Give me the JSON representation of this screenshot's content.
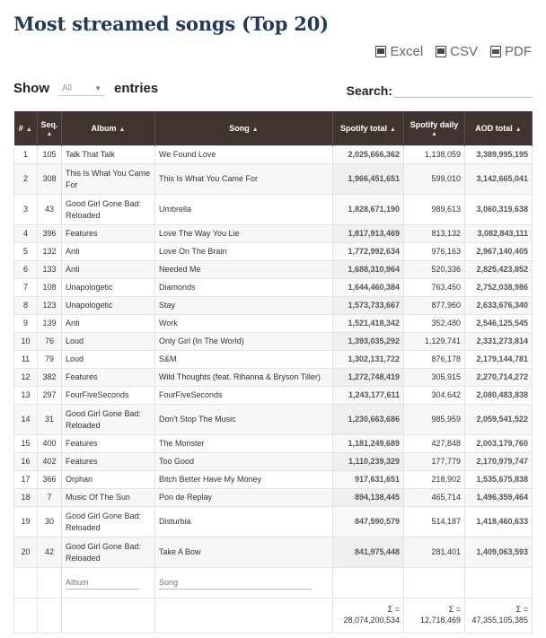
{
  "title": "Most streamed songs (Top 20)",
  "exports": [
    {
      "label": "Excel",
      "icon": "excel-icon"
    },
    {
      "label": "CSV",
      "icon": "csv-icon"
    },
    {
      "label": "PDF",
      "icon": "pdf-icon"
    }
  ],
  "controls": {
    "show_label": "Show",
    "length_value": "All",
    "entries_label": "entries",
    "search_label": "Search:",
    "search_value": ""
  },
  "table": {
    "headers": [
      "#",
      "Seq.",
      "Album",
      "Song",
      "Spotify total",
      "Spotify daily",
      "AOD total"
    ],
    "rows": [
      [
        "1",
        "105",
        "Talk That Talk",
        "We Found Love",
        "2,025,666,362",
        "1,138,059",
        "3,389,995,195"
      ],
      [
        "2",
        "308",
        "This Is What You Came For",
        "This Is What You Came For",
        "1,966,451,651",
        "599,010",
        "3,142,665,041"
      ],
      [
        "3",
        "43",
        "Good Girl Gone Bad: Reloaded",
        "Umbrella",
        "1,828,671,190",
        "989,613",
        "3,060,319,638"
      ],
      [
        "4",
        "396",
        "Features",
        "Love The Way You Lie",
        "1,817,913,469",
        "813,132",
        "3,082,843,111"
      ],
      [
        "5",
        "132",
        "Anti",
        "Love On The Brain",
        "1,772,992,634",
        "976,163",
        "2,967,140,405"
      ],
      [
        "6",
        "133",
        "Anti",
        "Needed Me",
        "1,688,310,964",
        "520,336",
        "2,825,423,852"
      ],
      [
        "7",
        "108",
        "Unapologetic",
        "Diamonds",
        "1,644,460,384",
        "763,450",
        "2,752,038,986"
      ],
      [
        "8",
        "123",
        "Unapologetic",
        "Stay",
        "1,573,733,667",
        "877,960",
        "2,633,676,340"
      ],
      [
        "9",
        "139",
        "Anti",
        "Work",
        "1,521,418,342",
        "352,480",
        "2,546,125,545"
      ],
      [
        "10",
        "76",
        "Loud",
        "Only Girl (In The World)",
        "1,393,035,292",
        "1,129,741",
        "2,331,273,814"
      ],
      [
        "11",
        "79",
        "Loud",
        "S&M",
        "1,302,131,722",
        "876,178",
        "2,179,144,781"
      ],
      [
        "12",
        "382",
        "Features",
        "Wild Thoughts (feat. Rihanna & Bryson Tiller)",
        "1,272,748,419",
        "305,915",
        "2,270,714,272"
      ],
      [
        "13",
        "297",
        "FourFiveSeconds",
        "FourFiveSeconds",
        "1,243,177,611",
        "304,642",
        "2,080,483,838"
      ],
      [
        "14",
        "31",
        "Good Girl Gone Bad: Reloaded",
        "Don't Stop The Music",
        "1,230,663,686",
        "985,959",
        "2,059,541,522"
      ],
      [
        "15",
        "400",
        "Features",
        "The Monster",
        "1,181,249,689",
        "427,848",
        "2,003,179,760"
      ],
      [
        "16",
        "402",
        "Features",
        "Too Good",
        "1,110,239,329",
        "177,779",
        "2,170,979,747"
      ],
      [
        "17",
        "366",
        "Orphan",
        "Bitch Better Have My Money",
        "917,631,651",
        "218,902",
        "1,535,675,838"
      ],
      [
        "18",
        "7",
        "Music Of The Sun",
        "Pon de Replay",
        "894,138,445",
        "465,714",
        "1,496,359,464"
      ],
      [
        "19",
        "30",
        "Good Girl Gone Bad: Reloaded",
        "Disturbia",
        "847,590,579",
        "514,187",
        "1,418,460,633"
      ],
      [
        "20",
        "42",
        "Good Girl Gone Bad: Reloaded",
        "Take A Bow",
        "841,975,448",
        "281,401",
        "1,409,063,593"
      ]
    ],
    "filters": {
      "album_placeholder": "Album",
      "song_placeholder": "Song"
    },
    "footer": {
      "sigma": "Σ =",
      "spotify_total": "28,074,200,534",
      "spotify_daily": "12,718,469",
      "aod_total": "47,355,105,385"
    }
  },
  "colors": {
    "title": "#203a57",
    "header_bg": "#3f3430"
  }
}
